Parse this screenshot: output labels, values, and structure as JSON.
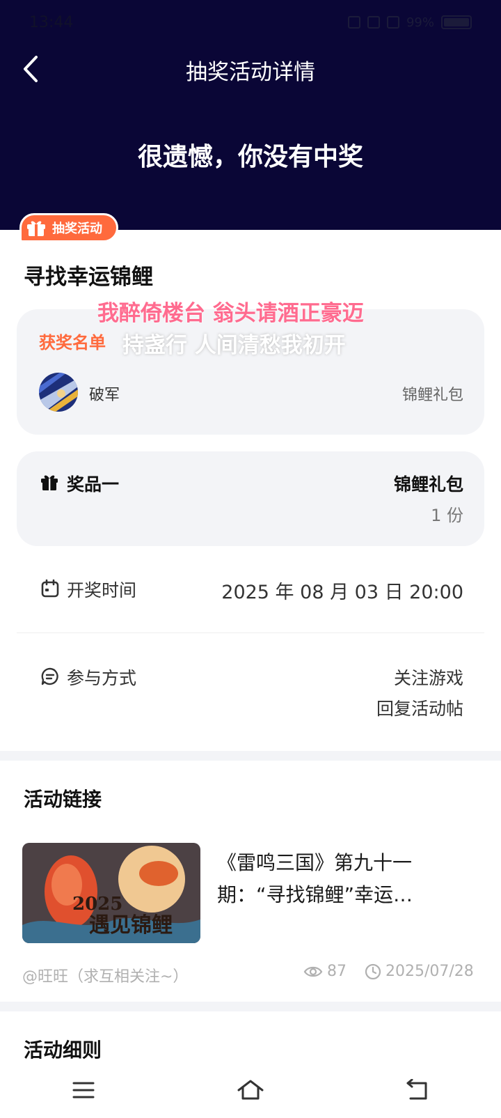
{
  "status_bar": {
    "time": "13:44",
    "battery": "99%"
  },
  "header": {
    "title": "抽奖活动详情",
    "result": "很遗憾，你没有中奖"
  },
  "badge": {
    "label": "抽奖活动"
  },
  "activity": {
    "title": "寻找幸运锦鲤"
  },
  "danmaku": {
    "line1": "我醉倚楼台 翁头请酒正豪迈",
    "line2": "持盏行 人间清愁我初开"
  },
  "winners": {
    "title": "获奖名单",
    "items": [
      {
        "name": "破军",
        "prize": "锦鲤礼包"
      }
    ]
  },
  "prize": {
    "label": "奖品一",
    "name": "锦鲤礼包",
    "qty": "1 份"
  },
  "draw_time": {
    "label": "开奖时间",
    "value": "2025 年 08 月 03 日 20:00"
  },
  "join": {
    "label": "参与方式",
    "methods": [
      "关注游戏",
      "回复活动帖"
    ]
  },
  "links_section": {
    "title": "活动链接"
  },
  "article": {
    "title": "《雷鸣三国》第九十一期：“寻找锦鲤”幸运…",
    "thumb_text_year": "2025",
    "thumb_text_caption": "遇见锦鲤",
    "author": "@旺旺（求互相关注~）",
    "views": "87",
    "date": "2025/07/28"
  },
  "rules_section": {
    "title": "活动细则"
  },
  "colors": {
    "header_bg": "#0a0636",
    "accent": "#ff6a3d",
    "card_bg": "#f3f4f7"
  },
  "icons": [
    "back-chevron-icon",
    "gift-icon",
    "calendar-icon",
    "chat-icon",
    "eye-icon",
    "clock-icon",
    "menu-icon",
    "home-icon",
    "return-icon"
  ]
}
